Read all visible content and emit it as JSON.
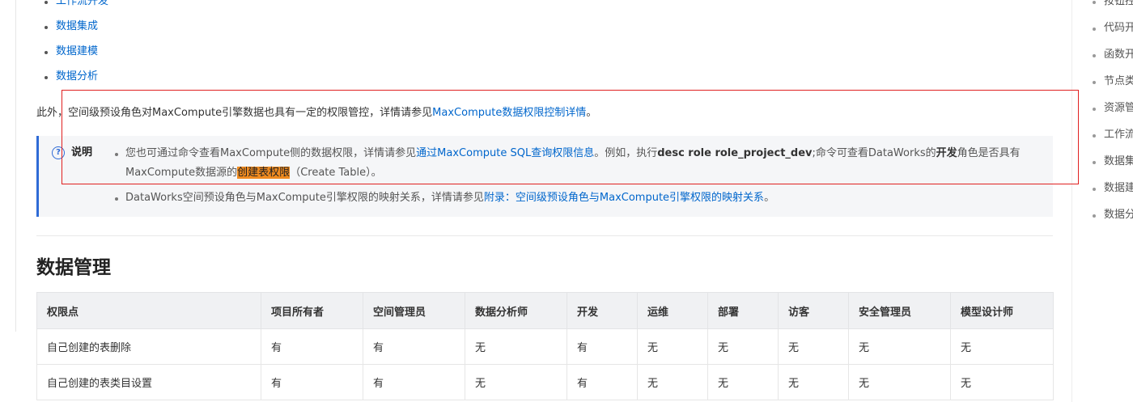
{
  "top_list": [
    {
      "label": "工作流开发"
    },
    {
      "label": "数据集成"
    },
    {
      "label": "数据建模"
    },
    {
      "label": "数据分析"
    }
  ],
  "paragraph": {
    "prefix": "此外，空间级预设角色对MaxCompute引擎数据也具有一定的权限管控，详情请参见",
    "link": "MaxCompute数据权限控制详情",
    "suffix": "。"
  },
  "note": {
    "icon": "question-circle-icon",
    "label": "说明",
    "item1": {
      "text_a": "您也可通过命令查看MaxCompute侧的数据权限，详情请参见",
      "link": "通过MaxCompute SQL查询权限信息",
      "text_b": "。例如，执行",
      "command": "desc role role_project_dev",
      "text_c": ";命令可查看DataWorks的",
      "role": "开发",
      "text_d": "角色是否具有MaxCompute数据源的",
      "highlight": "创建表权限",
      "text_e": "（Create Table）。"
    },
    "item2": {
      "text_a": "DataWorks空间预设角色与MaxCompute引擎权限的映射关系，详情请参见",
      "link": "附录：空间级预设角色与MaxCompute引擎权限的映射关系",
      "text_b": "。"
    }
  },
  "section_title": "数据管理",
  "table": {
    "headers": [
      "权限点",
      "项目所有者",
      "空间管理员",
      "数据分析师",
      "开发",
      "运维",
      "部署",
      "访客",
      "安全管理员",
      "模型设计师"
    ],
    "rows": [
      [
        "自己创建的表删除",
        "有",
        "有",
        "无",
        "有",
        "无",
        "无",
        "无",
        "无",
        "无"
      ],
      [
        "自己创建的表类目设置",
        "有",
        "有",
        "无",
        "有",
        "无",
        "无",
        "无",
        "无",
        "无"
      ]
    ]
  },
  "toc": [
    {
      "label": "按钮控"
    },
    {
      "label": "代码开"
    },
    {
      "label": "函数开"
    },
    {
      "label": "节点类"
    },
    {
      "label": "资源管"
    },
    {
      "label": "工作流"
    },
    {
      "label": "数据集"
    },
    {
      "label": "数据建"
    },
    {
      "label": "数据分"
    }
  ],
  "colors": {
    "link": "#0066cc",
    "annotation_box": "#e02020",
    "highlight": "#f08b20",
    "note_accent": "#2f6bd6"
  }
}
